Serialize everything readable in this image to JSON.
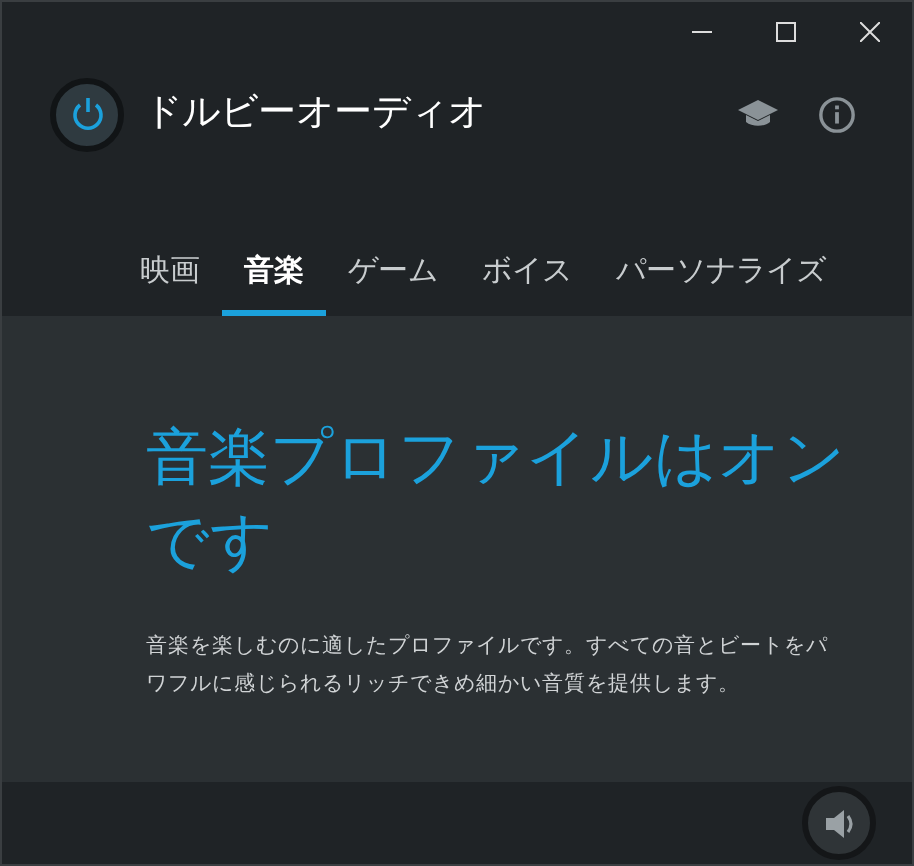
{
  "app": {
    "title": "ドルビーオーディオ",
    "power_on": true
  },
  "tabs": [
    {
      "label": "映画",
      "selected": false
    },
    {
      "label": "音楽",
      "selected": true
    },
    {
      "label": "ゲーム",
      "selected": false
    },
    {
      "label": "ボイス",
      "selected": false
    },
    {
      "label": "パーソナライズ",
      "selected": false
    }
  ],
  "profile": {
    "heading": "音楽プロファイルはオンです",
    "description": "音楽を楽しむのに適したプロファイルです。すべての音とビートをパワフルに感じられるリッチできめ細かい音質を提供します。"
  }
}
